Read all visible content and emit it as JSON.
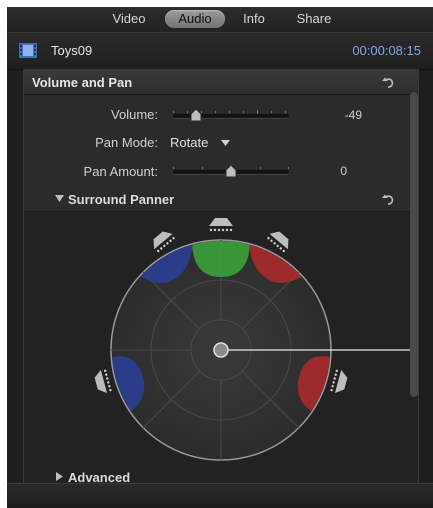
{
  "tabs": [
    {
      "label": "Video",
      "active": false
    },
    {
      "label": "Audio",
      "active": true
    },
    {
      "label": "Info",
      "active": false
    },
    {
      "label": "Share",
      "active": false
    }
  ],
  "clip": {
    "name": "Toys09",
    "timecode": "00:00:08:15",
    "icon": "film-clip-icon"
  },
  "volume_pan": {
    "title": "Volume and Pan",
    "volume": {
      "label": "Volume:",
      "value": "-49",
      "level": 0.2
    },
    "pan_mode": {
      "label": "Pan Mode:",
      "value": "Rotate"
    },
    "pan_amount": {
      "label": "Pan Amount:",
      "value": "0",
      "level": 0.5
    }
  },
  "surround_panner": {
    "title": "Surround Panner"
  },
  "advanced": {
    "title": "Advanced"
  },
  "colors": {
    "accent": "#7fa8e8",
    "green": "#3aa83a",
    "red": "#b02a2a",
    "blue": "#2a3f9a"
  }
}
